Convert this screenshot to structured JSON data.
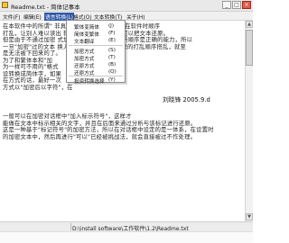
{
  "window": {
    "title": "Readme.txt - 简体记事本",
    "minimize": "_",
    "maximize": "□",
    "close": "×"
  },
  "menu": {
    "items": [
      "文件(F)",
      "编辑(E)",
      "语言转换(L)",
      "格式(O)",
      "文本转换(T)",
      "关于(H)"
    ],
    "active_index": 2
  },
  "dropdown": {
    "items": [
      {
        "label": "繁体变简体",
        "key": "(J)"
      },
      {
        "label": "简体变繁体",
        "key": "(F)"
      },
      {
        "label": "文本翻译",
        "key": "(E)"
      },
      {
        "label": "加密方式",
        "key": "(S)"
      },
      {
        "label": "加密方式",
        "key": "(T)"
      },
      {
        "label": "还原方式",
        "key": "(B)"
      },
      {
        "label": "还原方式",
        "key": "(Q)"
      },
      {
        "label": "投资转换选择",
        "key": "(Y)"
      }
    ]
  },
  "editor": {
    "lines": [
      "在本软件中的所谓\"              非真正的加密，只是通过所在软件时顺序",
      "打乱，让别人难以读出       转入后正确读存的人，可以把文本还原。",
      "但是由于不通过加密          式加密文本本来不具有判断顺序是正确的能力，所以",
      "一旦\"加密\"过的文本       换入了一个文字\"后\"，原来的打乱顺序搭乱，就至",
      "是无法被下回来的了。",
      "为了和繁体本和\"加",
      "为一样可不用的\"格式",
      "设转换成简体字，如果",
      "在方式的话，最好一次",
      "方式以\"加密后以字符\"，在",
      "",
      "",
      "一般可以在加密对话框中\"加入标示符号\"，这样才",
      "能做在文本中标示相关的文字，并且在后面来通过分析与该标记进行还原。",
      "这是一种基于\"标记符号\"的加密方法，所以在对话框中设定的是一体系，在设置时",
      "的加密文本中，然后再进行\"可以\"已经被挑战法，就会直接被过不作处理。"
    ],
    "signature": "刘晓锋  2005.9.d"
  },
  "status": {
    "path": "D:\\install software\\工作软件\\1.2\\Readme.txt"
  },
  "scrollbar": {
    "up": "▲",
    "down": "▼"
  }
}
